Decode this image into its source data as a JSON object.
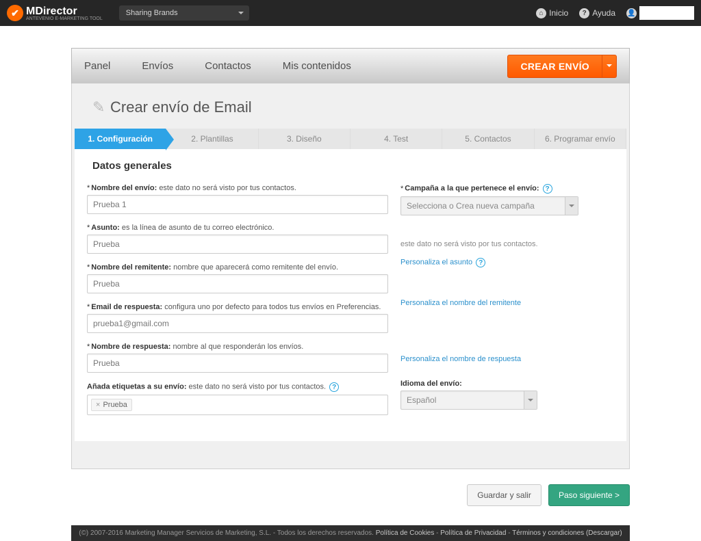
{
  "topbar": {
    "brand": "MDirector",
    "brand_sub": "ANTEVENIO E-MARKETING TOOL",
    "dropdown": "Sharing Brands",
    "inicio": "Inicio",
    "ayuda": "Ayuda"
  },
  "nav": {
    "panel": "Panel",
    "envios": "Envíos",
    "contactos": "Contactos",
    "mis_contenidos": "Mis contenidos",
    "crear_envio": "CREAR ENVÍO"
  },
  "page_title": "Crear envío de Email",
  "steps": [
    "1. Configuración",
    "2. Plantillas",
    "3. Diseño",
    "4. Test",
    "5. Contactos",
    "6. Programar envío"
  ],
  "section_title": "Datos generales",
  "form": {
    "nombre_envio": {
      "label": "Nombre del envío:",
      "hint": "este dato no será visto por tus contactos.",
      "value": "Prueba 1"
    },
    "asunto": {
      "label": "Asunto:",
      "hint": "es la línea de asunto de tu correo electrónico.",
      "value": "Prueba"
    },
    "remitente": {
      "label": "Nombre del remitente:",
      "hint": "nombre que aparecerá como remitente del envío.",
      "value": "Prueba"
    },
    "email_resp": {
      "label": "Email de respuesta:",
      "hint": "configura uno por defecto para todos tus envíos en Preferencias.",
      "value": "prueba1@gmail.com"
    },
    "nombre_resp": {
      "label": "Nombre de respuesta:",
      "hint": "nombre al que responderán los envíos.",
      "value": "Prueba"
    },
    "etiquetas": {
      "label": "Añada etiquetas a su envío:",
      "hint": "este dato no será visto por tus contactos.",
      "tag": "Prueba"
    }
  },
  "right": {
    "campana_label": "Campaña a la que pertenece el envío:",
    "campana_placeholder": "Selecciona o Crea nueva campaña",
    "campana_note": "este dato no será visto por tus contactos.",
    "link_asunto": "Personaliza el asunto",
    "link_remitente": "Personaliza el nombre del remitente",
    "link_respuesta": "Personaliza el nombre de respuesta",
    "idioma_label": "Idioma del envío:",
    "idioma_value": "Español"
  },
  "buttons": {
    "guardar": "Guardar y salir",
    "siguiente": "Paso siguiente >"
  },
  "footer": {
    "copy": "(©) 2007-2016 Marketing Manager Servicios de Marketing, S.L. - Todos los derechos reservados.",
    "cookies": "Política de Cookies",
    "privacidad": "Política de Privacidad",
    "terminos": "Términos y condiciones (Descargar)"
  }
}
